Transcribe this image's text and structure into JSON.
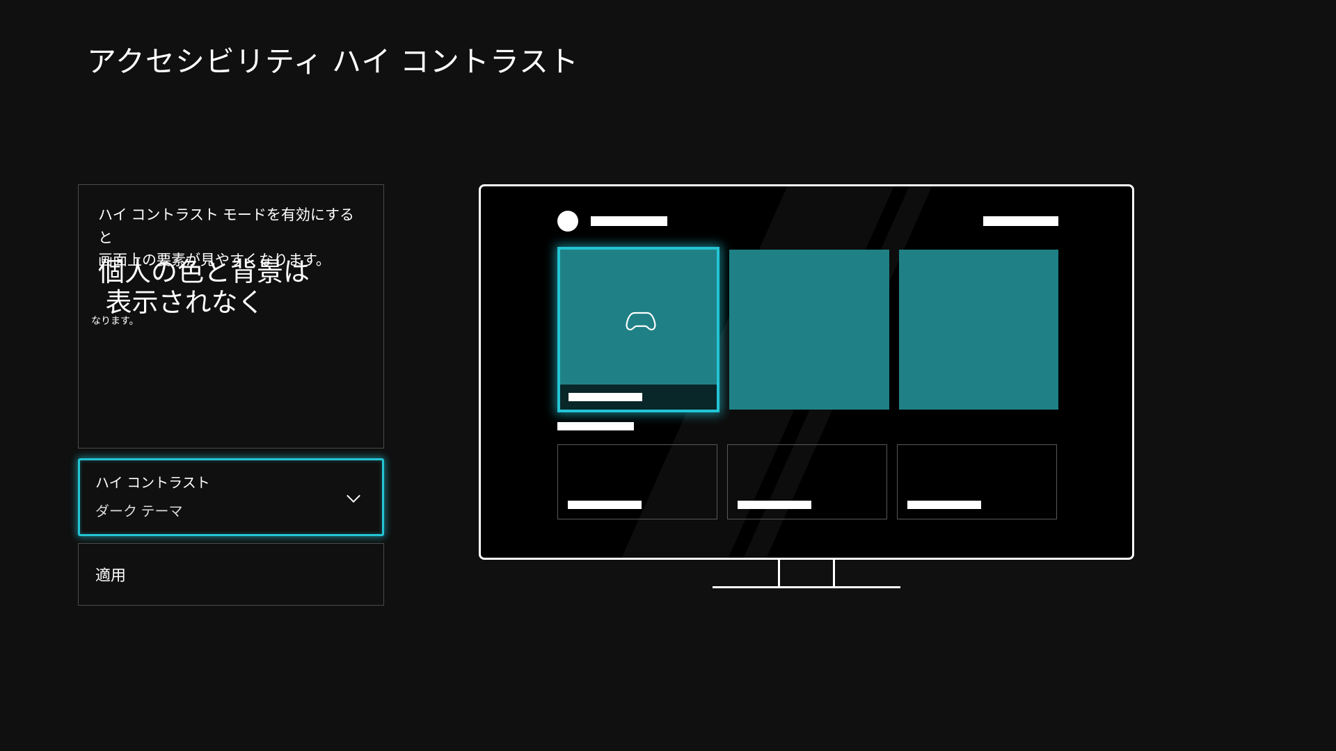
{
  "page": {
    "title": "アクセシビリティ ハイ コントラスト"
  },
  "description": {
    "line1": "ハイ コントラスト モードを有効にすると",
    "line2": "画面上の要素が見やすくなります。",
    "emphasis": "個人の色と背景は\n 表示されなく",
    "tail": "なります。"
  },
  "dropdown": {
    "label": "ハイ コントラスト",
    "value": "ダーク テーマ"
  },
  "apply": {
    "label": "適用"
  },
  "preview": {
    "selected_tile_icon": "controller-icon",
    "accent_color": "#1f8186",
    "highlight_color": "#24c4d4"
  }
}
